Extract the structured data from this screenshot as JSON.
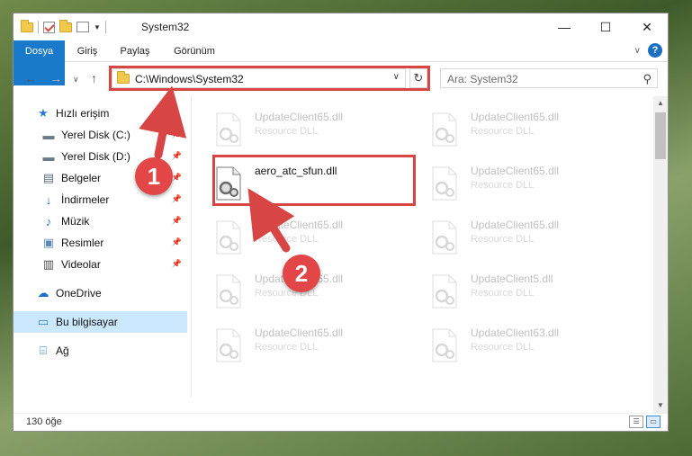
{
  "window": {
    "title": "System32",
    "controls": {
      "minimize": "—",
      "maximize": "☐",
      "close": "✕"
    }
  },
  "ribbon": {
    "tabs": [
      "Dosya",
      "Giriş",
      "Paylaş",
      "Görünüm"
    ],
    "help": "?"
  },
  "address": {
    "path": "C:\\Windows\\System32",
    "search_placeholder": "Ara: System32"
  },
  "sidebar": {
    "items": [
      {
        "label": "Hızlı erişim",
        "icon": "star-icon"
      },
      {
        "label": "Yerel Disk (C:)",
        "icon": "drive-icon",
        "pinned": true
      },
      {
        "label": "Yerel Disk (D:)",
        "icon": "drive-icon",
        "pinned": true
      },
      {
        "label": "Belgeler",
        "icon": "documents-icon",
        "pinned": true
      },
      {
        "label": "İndirmeler",
        "icon": "download-icon",
        "pinned": true
      },
      {
        "label": "Müzik",
        "icon": "music-icon",
        "pinned": true
      },
      {
        "label": "Resimler",
        "icon": "pictures-icon",
        "pinned": true
      },
      {
        "label": "Videolar",
        "icon": "videos-icon",
        "pinned": true
      },
      {
        "label": "OneDrive",
        "icon": "cloud-icon"
      },
      {
        "label": "Bu bilgisayar",
        "icon": "computer-icon",
        "selected": true
      },
      {
        "label": "Ağ",
        "icon": "network-icon"
      }
    ]
  },
  "files": {
    "main": {
      "name": "aero_atc_sfun.dll"
    },
    "ghosts": [
      {
        "name": "UpdateClient65.dll",
        "type": "Resource DLL"
      },
      {
        "name": "UpdateClient65.dll",
        "type": "Resource DLL"
      },
      {
        "name": "UpdateClient65.dll",
        "type": "Resource DLL"
      },
      {
        "name": "UpdateClient65.dll",
        "type": "Resource DLL"
      },
      {
        "name": "UpdateClient65.dll",
        "type": "Resource DLL"
      },
      {
        "name": "UpdateClient65.dll",
        "type": "Resource DLL"
      },
      {
        "name": "UpdateClient5.dll",
        "type": "Resource DLL"
      },
      {
        "name": "UpdateClient65.dll",
        "type": "Resource DLL"
      },
      {
        "name": "UpdateClient63.dll",
        "type": "Resource DLL"
      }
    ]
  },
  "status": {
    "count": "130 öğe"
  },
  "callouts": [
    "1",
    "2"
  ],
  "colors": {
    "accent": "#1979ca",
    "highlight": "#d84545",
    "selected": "#cce8ff"
  }
}
